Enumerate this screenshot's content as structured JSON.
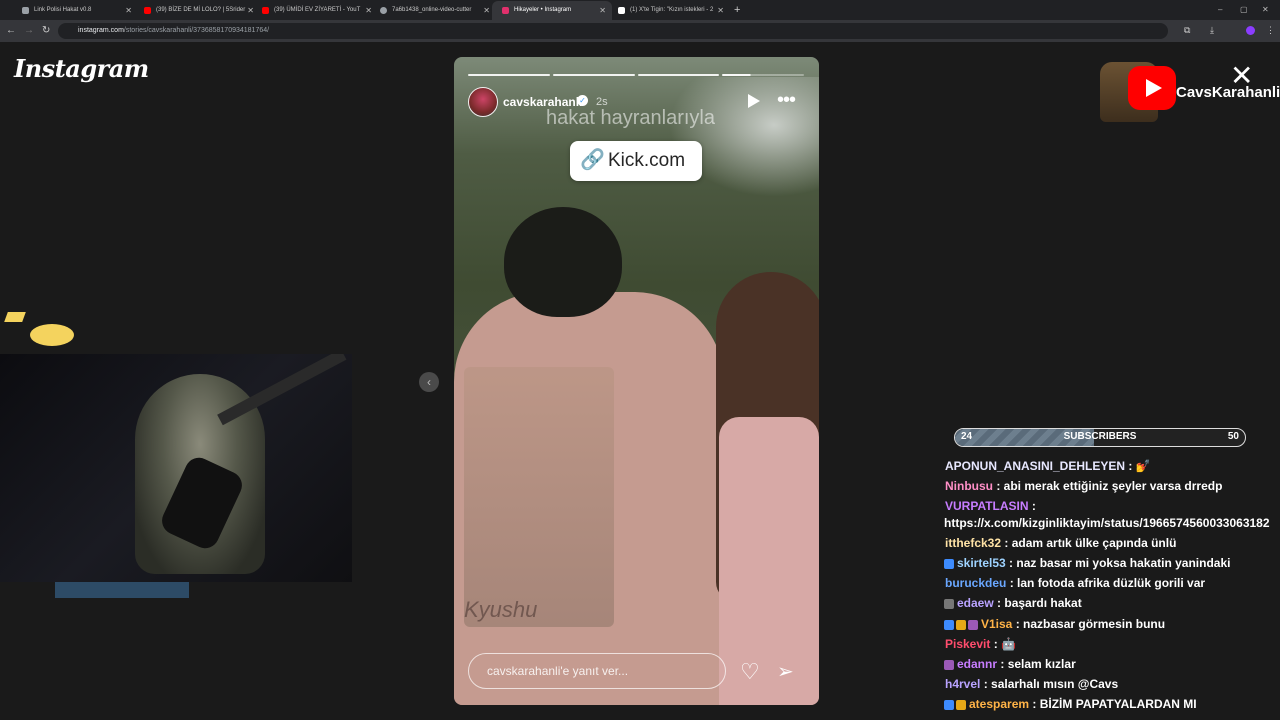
{
  "browser": {
    "tabs": [
      {
        "title": "Link Polisi Hakat v0.8",
        "color": "#9aa0a6"
      },
      {
        "title": "(39) BİZE DE Mİ LOLO? | 5Srider",
        "color": "#ff0000"
      },
      {
        "title": "(39) ÜMİDİ EV ZİYARETİ - YouT",
        "color": "#ff0000"
      },
      {
        "title": "7a6b1438_online-video-cutter",
        "color": "#9aa0a6"
      },
      {
        "title": "Hikayeler • Instagram",
        "color": "#e1306c"
      },
      {
        "title": "(1) X'te Tigin: \"Kızın istekleri - 2",
        "color": "#ffffff"
      }
    ],
    "new_tab": "+",
    "window_controls": {
      "minimize": "–",
      "maximize": "▢",
      "close": "✕"
    },
    "url_host": "instagram.com",
    "url_path": "/stories/cavskarahanli/3736858170934181764/"
  },
  "instagram": {
    "logo": "Instagram",
    "story": {
      "username": "cavskarahanli",
      "time": "2s",
      "overlay_text": "hakat hayranlarıyla",
      "link_label": "Kick.com",
      "shirt_text": "Kyushu",
      "reply_placeholder": "cavskarahanli'e yanıt ver...",
      "progress_segments": 4,
      "progress_current_fraction": 0.35
    },
    "close_icon": "✕",
    "prev_icon": "‹"
  },
  "overlay": {
    "channel_name": "CavsKarahanli",
    "subscribers": {
      "current": "24",
      "label": "SUBSCRIBERS",
      "goal": "50",
      "fraction": 0.48
    }
  },
  "chat": [
    {
      "user": "APONUN_ANASINI_DEHLEYEN",
      "color": "#e8e8ff",
      "text": ": 💅",
      "badges": []
    },
    {
      "user": "Ninbusu",
      "color": "#ff8fc7",
      "text": ": abi merak ettiğiniz şeyler varsa drredp",
      "badges": []
    },
    {
      "user": "VURPATLASIN",
      "color": "#c77dff",
      "text": ":",
      "badges": [],
      "continuation": "https://x.com/kizginliktayim/status/1966574560033063182"
    },
    {
      "user": "itthefck32",
      "color": "#ffe3a6",
      "text": ": adam artık ülke çapında ünlü",
      "badges": []
    },
    {
      "user": "skirtel53",
      "color": "#9fd3ff",
      "text": ": naz basar mi yoksa hakatin yanindaki",
      "badges": [
        "#3d8bfd"
      ]
    },
    {
      "user": "buruckdeu",
      "color": "#6aa7ff",
      "text": ": lan fotoda afrika düzlük gorili var",
      "badges": []
    },
    {
      "user": "edaew",
      "color": "#b9a3ff",
      "text": ": başardı hakat",
      "badges": [
        "#777"
      ]
    },
    {
      "user": "V1isa",
      "color": "#ffb347",
      "text": ": nazbasar görmesin bunu",
      "badges": [
        "#3d8bfd",
        "#e6a817",
        "#9b59b6"
      ]
    },
    {
      "user": "Piskevit",
      "color": "#ff4d6d",
      "text": ": 🤖",
      "badges": []
    },
    {
      "user": "edannr",
      "color": "#c77dff",
      "text": ": selam kızlar",
      "badges": [
        "#9b59b6"
      ]
    },
    {
      "user": "h4rvel",
      "color": "#b9a3ff",
      "text": ": salarhalı mısın @Cavs",
      "badges": []
    },
    {
      "user": "atesparem",
      "color": "#ffb347",
      "text": ": BİZİM PAPATYALARDAN MI",
      "badges": [
        "#3d8bfd",
        "#e6a817"
      ]
    }
  ]
}
